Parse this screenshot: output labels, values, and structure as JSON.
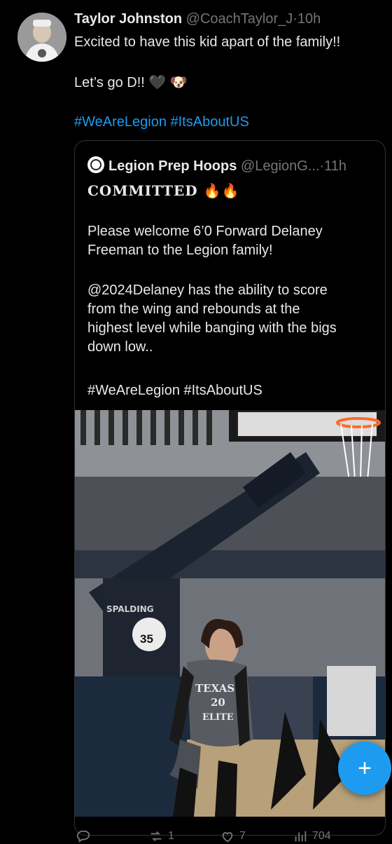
{
  "tweet": {
    "author_name": "Taylor Johnston",
    "author_handle": "@CoachTaylor_J",
    "separator": "·",
    "time": "10h",
    "line1": "Excited to have this kid apart of the family!!",
    "line2": "Let’s go D!! 🖤 🐶",
    "hashtags": "#WeAreLegion #ItsAboutUS"
  },
  "quoted": {
    "author_name": "Legion Prep Hoops",
    "author_handle": "@LegionG...",
    "separator": "·",
    "time": "11h",
    "committed": "COMMITTED 🔥🔥",
    "p1_line1": "Please welcome 6’0 Forward Delaney",
    "p1_line2": "Freeman to the Legion family!",
    "p2_line1": "@2024Delaney has the ability to score",
    "p2_line2": "from the wing and rebounds at the",
    "p2_line3": "highest level while banging with the bigs",
    "p2_line4": "down low..",
    "hashtags": "#WeAreLegion #ItsAboutUS",
    "image": {
      "jersey_text": "TEXAS",
      "jersey_number": "20",
      "jersey_sub": "ELITE",
      "pad_number": "35",
      "brand": "SPALDING"
    }
  },
  "actions": {
    "replies": "",
    "retweets": "1",
    "likes": "7",
    "views": "704"
  },
  "fab": {
    "icon": "plus-icon",
    "label": "+"
  },
  "colors": {
    "accent": "#1d9bf0",
    "background": "#000000",
    "muted": "#71767b"
  }
}
